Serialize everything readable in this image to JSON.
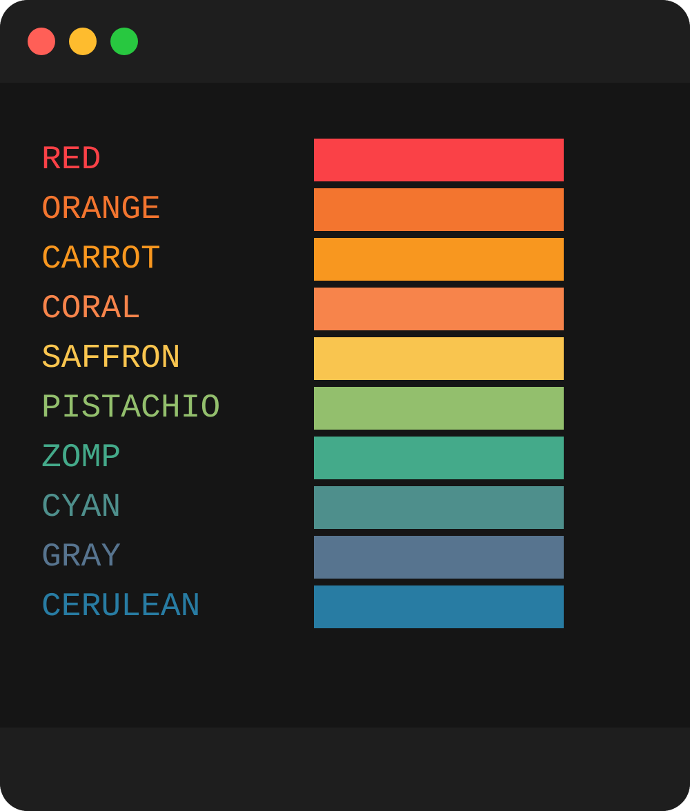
{
  "window": {
    "traffic_lights": [
      {
        "name": "close",
        "color": "#ff5f57"
      },
      {
        "name": "minimize",
        "color": "#febc2e"
      },
      {
        "name": "zoom",
        "color": "#28c840"
      }
    ]
  },
  "colors": [
    {
      "label": "RED",
      "hex": "#fa4147"
    },
    {
      "label": "ORANGE",
      "hex": "#f3752f"
    },
    {
      "label": "CARROT",
      "hex": "#f8971f"
    },
    {
      "label": "CORAL",
      "hex": "#f7844b"
    },
    {
      "label": "SAFFRON",
      "hex": "#f9c54f"
    },
    {
      "label": "PISTACHIO",
      "hex": "#93bf6d"
    },
    {
      "label": "ZOMP",
      "hex": "#44aa8a"
    },
    {
      "label": "CYAN",
      "hex": "#4e8f8c"
    },
    {
      "label": "GRAY",
      "hex": "#57748f"
    },
    {
      "label": "CERULEAN",
      "hex": "#287ca3"
    }
  ]
}
